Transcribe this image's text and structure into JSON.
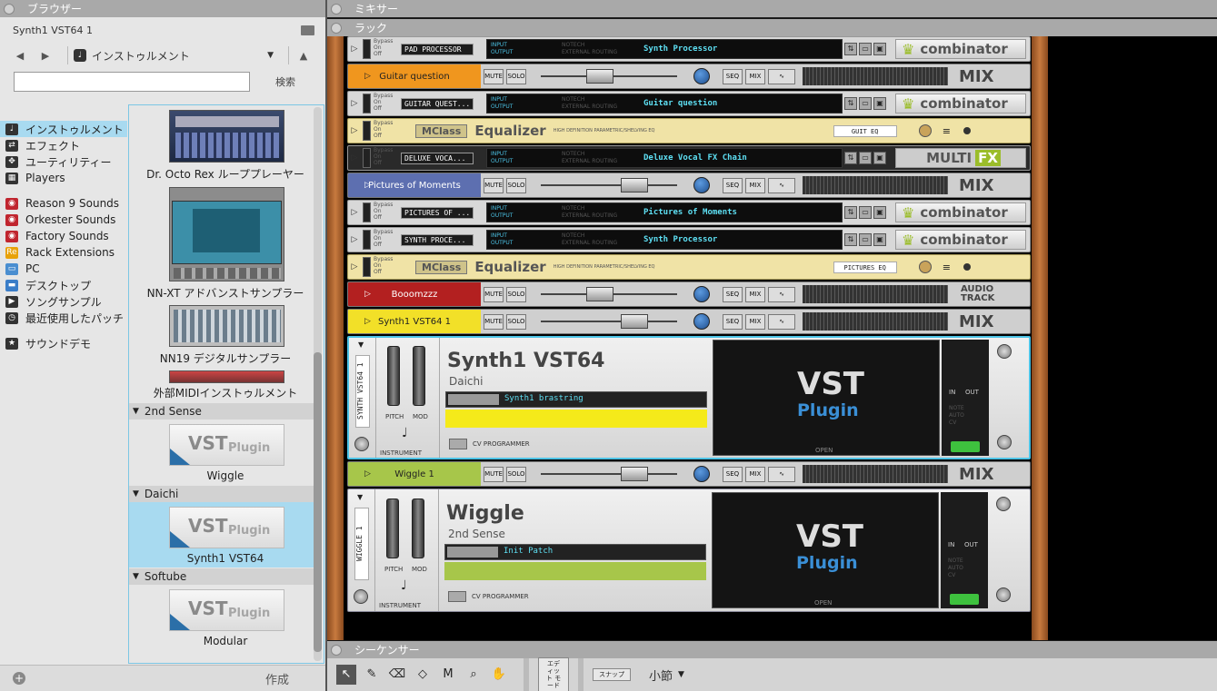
{
  "browser": {
    "title": "ブラウザー",
    "device": "Synth1 VST64 1",
    "location": "インストゥルメント",
    "search_label": "検索",
    "search_value": "",
    "places": [
      {
        "label": "インストゥルメント",
        "icon": "instrument-icon",
        "selected": true
      },
      {
        "label": "エフェクト",
        "icon": "effect-icon"
      },
      {
        "label": "ユーティリティー",
        "icon": "utility-icon"
      },
      {
        "label": "Players",
        "icon": "players-icon"
      },
      {
        "label": "Reason 9 Sounds",
        "icon": "sound-bank-icon"
      },
      {
        "label": "Orkester Sounds",
        "icon": "sound-bank-icon"
      },
      {
        "label": "Factory Sounds",
        "icon": "sound-bank-icon"
      },
      {
        "label": "Rack Extensions",
        "icon": "re-icon"
      },
      {
        "label": "PC",
        "icon": "pc-icon"
      },
      {
        "label": "デスクトップ",
        "icon": "desktop-icon"
      },
      {
        "label": "ソングサンプル",
        "icon": "song-icon"
      },
      {
        "label": "最近使用したパッチ",
        "icon": "recent-icon"
      },
      {
        "label": "サウンドデモ",
        "icon": "star-icon"
      }
    ],
    "items": {
      "i1": "Dr. Octo Rex ループプレーヤー",
      "i2": "NN-XT アドバンストサンプラー",
      "i3": "NN19 デジタルサンプラー",
      "i4": "外部MIDIインストゥルメント"
    },
    "groups": {
      "g1": "2nd Sense",
      "g2": "Daichi",
      "g3": "Softube"
    },
    "vst_items": {
      "w": "Wiggle",
      "s": "Synth1 VST64",
      "m": "Modular"
    },
    "vst_thumb": {
      "v": "VST",
      "p": "Plugin"
    },
    "create": "作成"
  },
  "panels": {
    "mixer": "ミキサー",
    "rack": "ラック",
    "sequencer": "シーケンサー"
  },
  "rack": {
    "bypass": [
      "Bypass",
      "On",
      "Off"
    ],
    "io": [
      "INPUT",
      "OUTPUT"
    ],
    "ext": [
      "NOTECH",
      "EXTERNAL ROUTING"
    ],
    "combinator": "combinator",
    "mute": "MUTE",
    "solo": "SOLO",
    "seq": "SEQ",
    "mixbtn": "MIX",
    "mix": "MIX",
    "audio": "AUDIO",
    "track": "TRACK",
    "mclass": "MClass",
    "equalizer": "Equalizer",
    "eqsub": "HIGH DEFINITION PARAMETRIC/SHELVING EQ",
    "multi": "MULTI",
    "fx": "FX",
    "c1": {
      "name": "PAD PROCESSOR",
      "patch": "Synth Processor"
    },
    "m1": {
      "label": "Guitar question",
      "color": "#f0961e"
    },
    "c2": {
      "name": "GUITAR QUEST...",
      "patch": "Guitar question"
    },
    "eq1": {
      "patch": "GUIT EQ"
    },
    "c3": {
      "name": "DELUXE VOCA...",
      "patch": "Deluxe Vocal FX Chain"
    },
    "m2": {
      "label": "Pictures of Moments",
      "color": "#5d6fb0"
    },
    "c4": {
      "name": "PICTURES OF ...",
      "patch": "Pictures of Moments"
    },
    "c5": {
      "name": "SYNTH PROCE...",
      "patch": "Synth Processor"
    },
    "eq2": {
      "patch": "PICTURES EQ"
    },
    "m3": {
      "label": "Booomzzz",
      "color": "#b32020"
    },
    "m4": {
      "label": "Synth1 VST64 1",
      "color": "#f2e028"
    },
    "v1": {
      "side": "SYNTH VST64 1",
      "name": "Synth1 VST64",
      "maker": "Daichi",
      "patch": "Synth1 brastring",
      "color": "#f5ea1a"
    },
    "m5": {
      "label": "Wiggle 1",
      "color": "#a7c64a"
    },
    "v2": {
      "side": "WIGGLE 1",
      "name": "Wiggle",
      "maker": "2nd Sense",
      "patch": "Init Patch",
      "color": "#a7c64a"
    },
    "vst_labels": {
      "pitch": "PITCH",
      "mod": "MOD",
      "instrument": "INSTRUMENT",
      "cv": "CV PROGRAMMER",
      "vst": "VST",
      "plugin": "Plugin",
      "open": "OPEN",
      "in": "IN",
      "out": "OUT",
      "nac": [
        "NOTE",
        "AUTO",
        "CV"
      ]
    }
  },
  "sequencer": {
    "edit": "エディット モード",
    "snap": "スナップ",
    "bar": "小節"
  }
}
